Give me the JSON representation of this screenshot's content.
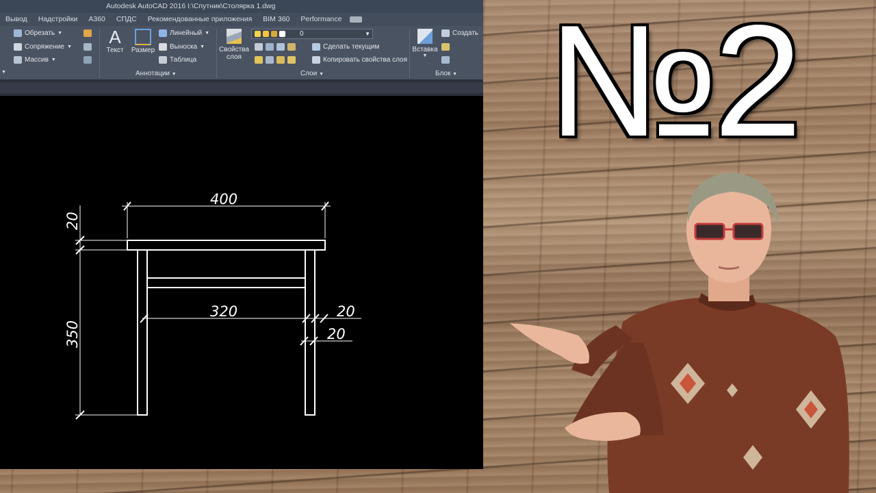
{
  "window": {
    "title": "Autodesk AutoCAD 2016    I:\\Спутник\\Столярка 1.dwg"
  },
  "ribbon_tabs": [
    {
      "label": "Вывод"
    },
    {
      "label": "Надстройки"
    },
    {
      "label": "A360"
    },
    {
      "label": "СПДС"
    },
    {
      "label": "Рекомендованные приложения"
    },
    {
      "label": "BIM 360"
    },
    {
      "label": "Performance"
    }
  ],
  "ribbon": {
    "modify": {
      "trim": "Обрезать",
      "fillet": "Сопряжение",
      "array": "Массив"
    },
    "annotation": {
      "text": "Текст",
      "dimension": "Размер",
      "linear": "Линейный",
      "leader": "Выноска",
      "table": "Таблица",
      "panel_title": "Аннотации"
    },
    "layers": {
      "properties": "Свойства слоя",
      "properties_line1": "Свойства",
      "properties_line2": "слоя",
      "current_layer": "0",
      "make_current": "Сделать текущим",
      "match_layer": "Копировать свойства слоя",
      "panel_title": "Слои"
    },
    "block": {
      "insert": "Вставка",
      "create": "Создать",
      "panel_title": "Блок"
    }
  },
  "drawing": {
    "dimensions": {
      "width_top": "400",
      "width_inner": "320",
      "top_thickness": "20",
      "leg_height": "350",
      "leg_width_1": "20",
      "leg_width_2": "20"
    }
  },
  "headline": {
    "text": "№2"
  },
  "colors": {
    "titlebar": "#3b4656",
    "ribbon": "#4a5362",
    "canvas": "#000000",
    "drawing_lines": "#ffffff"
  }
}
